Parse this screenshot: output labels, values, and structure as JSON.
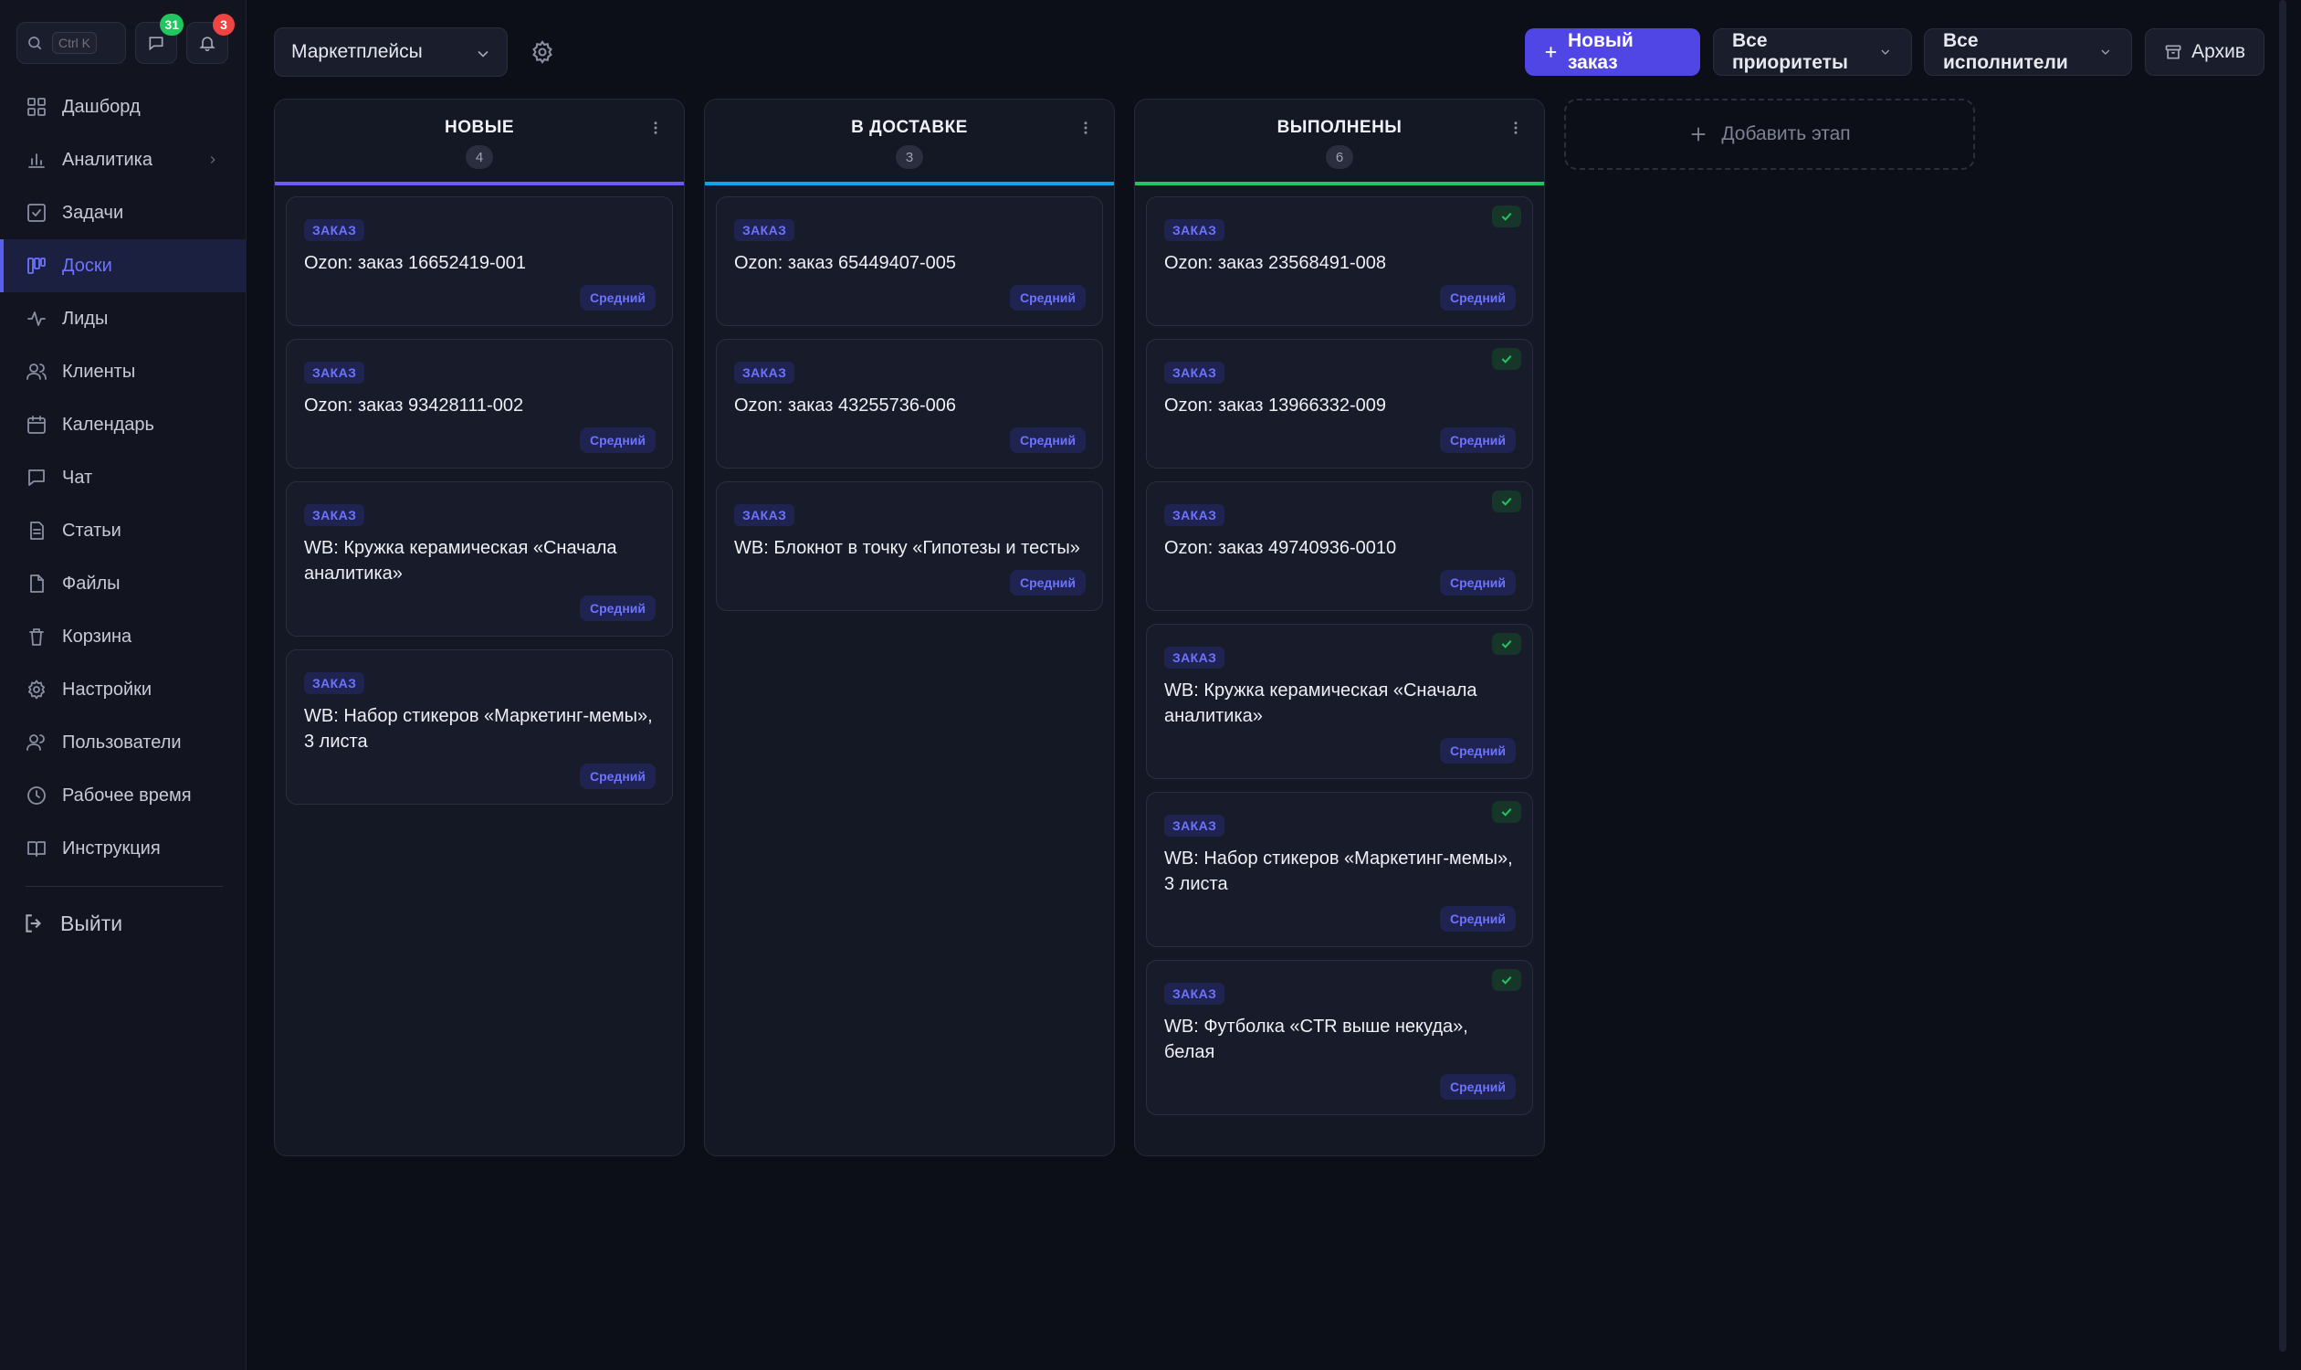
{
  "sidebar": {
    "search_kbd": "Ctrl K",
    "messages_count": "31",
    "notifications_count": "3",
    "items": [
      {
        "label": "Дашборд",
        "icon": "dashboard-icon"
      },
      {
        "label": "Аналитика",
        "icon": "analytics-icon"
      },
      {
        "label": "Задачи",
        "icon": "tasks-icon"
      },
      {
        "label": "Доски",
        "icon": "boards-icon"
      },
      {
        "label": "Лиды",
        "icon": "leads-icon"
      },
      {
        "label": "Клиенты",
        "icon": "clients-icon"
      },
      {
        "label": "Календарь",
        "icon": "calendar-icon"
      },
      {
        "label": "Чат",
        "icon": "chat-icon"
      },
      {
        "label": "Статьи",
        "icon": "articles-icon"
      },
      {
        "label": "Файлы",
        "icon": "files-icon"
      },
      {
        "label": "Корзина",
        "icon": "trash-icon"
      },
      {
        "label": "Настройки",
        "icon": "settings-icon"
      },
      {
        "label": "Пользователи",
        "icon": "users-icon"
      },
      {
        "label": "Рабочее время",
        "icon": "clock-icon"
      },
      {
        "label": "Инструкция",
        "icon": "book-icon"
      }
    ],
    "active_item": "Доски",
    "logout_label": "Выйти"
  },
  "toolbar": {
    "board_select_value": "Маркетплейсы",
    "new_order_label": "Новый заказ",
    "priority_filter_label": "Все приоритеты",
    "executor_filter_label": "Все исполнители",
    "archive_label": "Архив"
  },
  "columns": [
    {
      "title": "НОВЫЕ",
      "count": "4",
      "accent": "#6d5cf0",
      "cards": [
        {
          "tag": "ЗАКАЗ",
          "title": "Ozon: заказ 16652419-001",
          "priority": "Средний"
        },
        {
          "tag": "ЗАКАЗ",
          "title": "Ozon: заказ 93428111-002",
          "priority": "Средний"
        },
        {
          "tag": "ЗАКАЗ",
          "title": "WB: Кружка керамическая «Сначала аналитика»",
          "priority": "Средний"
        },
        {
          "tag": "ЗАКАЗ",
          "title": "WB: Набор стикеров «Маркетинг-мемы», 3 листа",
          "priority": "Средний"
        }
      ]
    },
    {
      "title": "В ДОСТАВКЕ",
      "count": "3",
      "accent": "#0ea5e9",
      "cards": [
        {
          "tag": "ЗАКАЗ",
          "title": "Ozon: заказ 65449407-005",
          "priority": "Средний"
        },
        {
          "tag": "ЗАКАЗ",
          "title": "Ozon: заказ 43255736-006",
          "priority": "Средний"
        },
        {
          "tag": "ЗАКАЗ",
          "title": "WB: Блокнот в точку «Гипотезы и тесты»",
          "priority": "Средний"
        }
      ]
    },
    {
      "title": "ВЫПОЛНЕНЫ",
      "count": "6",
      "accent": "#22c55e",
      "done": true,
      "cards": [
        {
          "tag": "ЗАКАЗ",
          "title": "Ozon: заказ 23568491-008",
          "priority": "Средний"
        },
        {
          "tag": "ЗАКАЗ",
          "title": "Ozon: заказ 13966332-009",
          "priority": "Средний"
        },
        {
          "tag": "ЗАКАЗ",
          "title": "Ozon: заказ 49740936-0010",
          "priority": "Средний"
        },
        {
          "tag": "ЗАКАЗ",
          "title": "WB: Кружка керамическая «Сначала аналитика»",
          "priority": "Средний"
        },
        {
          "tag": "ЗАКАЗ",
          "title": "WB: Набор стикеров «Маркетинг-мемы», 3 листа",
          "priority": "Средний"
        },
        {
          "tag": "ЗАКАЗ",
          "title": "WB: Футболка «CTR выше некуда», белая",
          "priority": "Средний"
        }
      ]
    }
  ],
  "add_stage_label": "Добавить этап",
  "colors": {
    "brand": "#4f46e5",
    "active_nav": "#6d72ff",
    "done_check": "#22c55e"
  }
}
